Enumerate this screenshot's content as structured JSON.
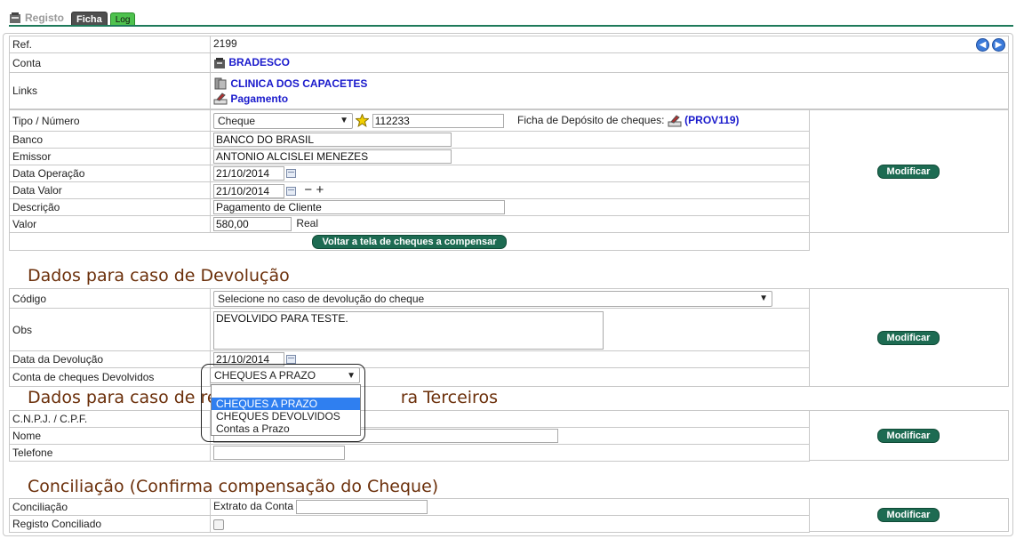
{
  "tabs": {
    "registo": "Registo",
    "ficha": "Ficha",
    "log": "Log"
  },
  "ref": {
    "label": "Ref.",
    "value": "2199"
  },
  "conta": {
    "label": "Conta",
    "value": "BRADESCO"
  },
  "links": {
    "label": "Links",
    "item1": "CLINICA DOS CAPACETES",
    "item2": "Pagamento"
  },
  "tipo": {
    "label": "Tipo / Número",
    "select": "Cheque",
    "numero": "112233",
    "ficha_label": "Ficha de Depósito de cheques:",
    "ficha_link": "(PROV119)"
  },
  "banco": {
    "label": "Banco",
    "value": "BANCO DO BRASIL"
  },
  "emissor": {
    "label": "Emissor",
    "value": "ANTONIO ALCISLEI MENEZES"
  },
  "data_operacao": {
    "label": "Data Operação",
    "value": "21/10/2014"
  },
  "data_valor": {
    "label": "Data Valor",
    "value": "21/10/2014",
    "minus": "−",
    "plus": "+"
  },
  "descricao": {
    "label": "Descrição",
    "value": "Pagamento de Cliente"
  },
  "valor": {
    "label": "Valor",
    "value": "580,00",
    "moeda": "Real"
  },
  "voltar_button": "Voltar a tela de cheques a compensar",
  "modificar_label": "Modificar",
  "devolucao": {
    "title": "Dados para caso de Devolução",
    "codigo_label": "Código",
    "codigo_value": "Selecione no caso de devolução do cheque",
    "obs_label": "Obs",
    "obs_value": "DEVOLVIDO PARA TESTE.",
    "data_label": "Data da Devolução",
    "data_value": "21/10/2014",
    "conta_label": "Conta de cheques Devolvidos",
    "conta_value": "CHEQUES A PRAZO",
    "options": [
      "CHEQUES A PRAZO",
      "CHEQUES DEVOLVIDOS",
      "Contas a Prazo"
    ]
  },
  "repasse": {
    "title_left": "Dados para caso de rep",
    "title_right": "ra Terceiros",
    "cnpj_label": "C.N.P.J. / C.P.F.",
    "nome_label": "Nome",
    "telefone_label": "Telefone"
  },
  "conciliacao": {
    "title": "Conciliação (Confirma compensação do Cheque)",
    "label": "Conciliação",
    "extrato_label": "Extrato da Conta",
    "registo_label": "Registo Conciliado"
  },
  "colors": {
    "accent": "#1d6b52",
    "section_title": "#6b2f0a",
    "link": "#1a1acc",
    "highlight": "#2f7ff0"
  },
  "icons": [
    "register-icon",
    "bank-icon",
    "client-icon",
    "payment-icon",
    "star-icon",
    "calendar-icon",
    "back-nav-icon",
    "forward-nav-icon"
  ]
}
